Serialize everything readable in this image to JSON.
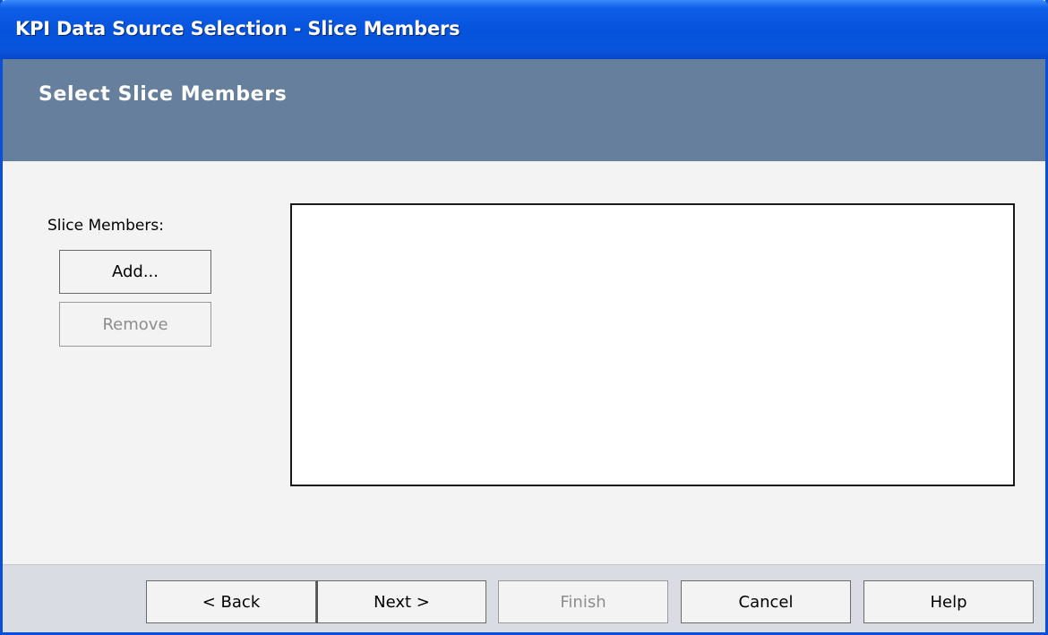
{
  "window": {
    "title": "KPI Data Source Selection - Slice Members"
  },
  "header": {
    "title": "Select Slice Members"
  },
  "slice_members": {
    "label": "Slice Members:",
    "add_label": "Add...",
    "remove_label": "Remove",
    "items": []
  },
  "footer": {
    "back_label": "< Back",
    "next_label": "Next >",
    "finish_label": "Finish",
    "cancel_label": "Cancel",
    "help_label": "Help"
  },
  "colors": {
    "titlebar": "#0553dc",
    "header_band": "#667f9c",
    "content_bg": "#f3f3f3",
    "footer_bg": "#d9dde3"
  }
}
